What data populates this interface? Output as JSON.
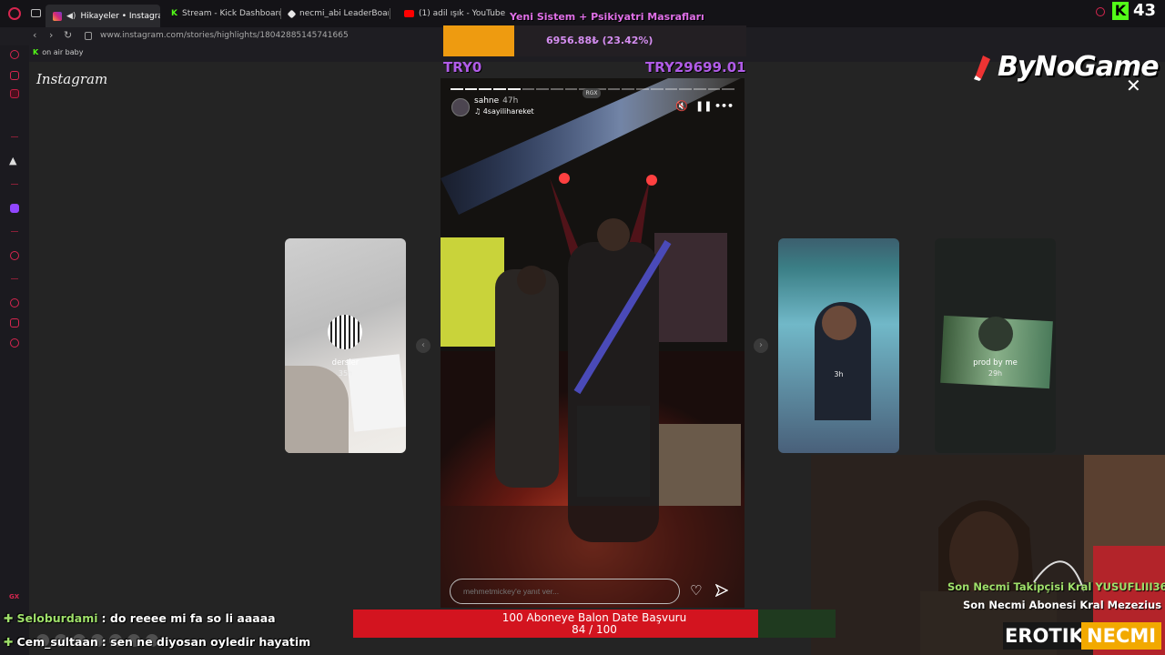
{
  "browser": {
    "tabs": [
      {
        "label": "Hikayeler • Instagram",
        "active": true
      },
      {
        "label": "Stream - Kick Dashboard",
        "active": false
      },
      {
        "label": "necmi_abi LeaderBoard",
        "active": false
      },
      {
        "label": "(1) adil ışık - YouTube",
        "active": false
      }
    ],
    "url": "www.instagram.com/stories/highlights/18042885145741665",
    "bookmark": "on air baby"
  },
  "instagram": {
    "logo": "Instagram",
    "side_stories": [
      {
        "label": "dersler",
        "time": "35h"
      },
      {
        "label": "",
        "time": "3h"
      },
      {
        "label": "prod by me",
        "time": "29h"
      }
    ],
    "story": {
      "user": "sahne",
      "time": "47h",
      "music": "4sayilihareket",
      "badge": "RGX",
      "reply_placeholder": "mehmetmickey'e yanıt ver...",
      "progress_total": 20,
      "progress_done": 5
    }
  },
  "overlay": {
    "donation_title": "Yeni Sistem + Psikiyatri Masrafları",
    "donation_amount": "6956.88₺ (23.42%)",
    "donation_progress": 0.2342,
    "try_min": "TRY0",
    "try_max": "TRY29699.01",
    "brand": "ByNoGame",
    "viewers": "43",
    "follower_text": "Son Necmi Takipçisi Kral YUSUFLIII36",
    "sub_text": "Son Necmi Abonesi Kral Mezezius",
    "brand_left": "EROTIK",
    "brand_right": "NECMI",
    "goal_title": "100 Aboneye Balon Date Başvuru",
    "goal_count": "84 / 100",
    "goal_progress": 0.84
  },
  "chat": [
    {
      "user": "Seloburdami",
      "message": ": do reeee mi fa so li aaaaa"
    },
    {
      "user": "Cem_sultaan",
      "message": ": sen ne diyosan oyledir hayatim"
    }
  ],
  "colors": {
    "accent": "#d6264f",
    "kick": "#53fc18",
    "donation": "#ee9b10",
    "goal": "#d3141f"
  }
}
